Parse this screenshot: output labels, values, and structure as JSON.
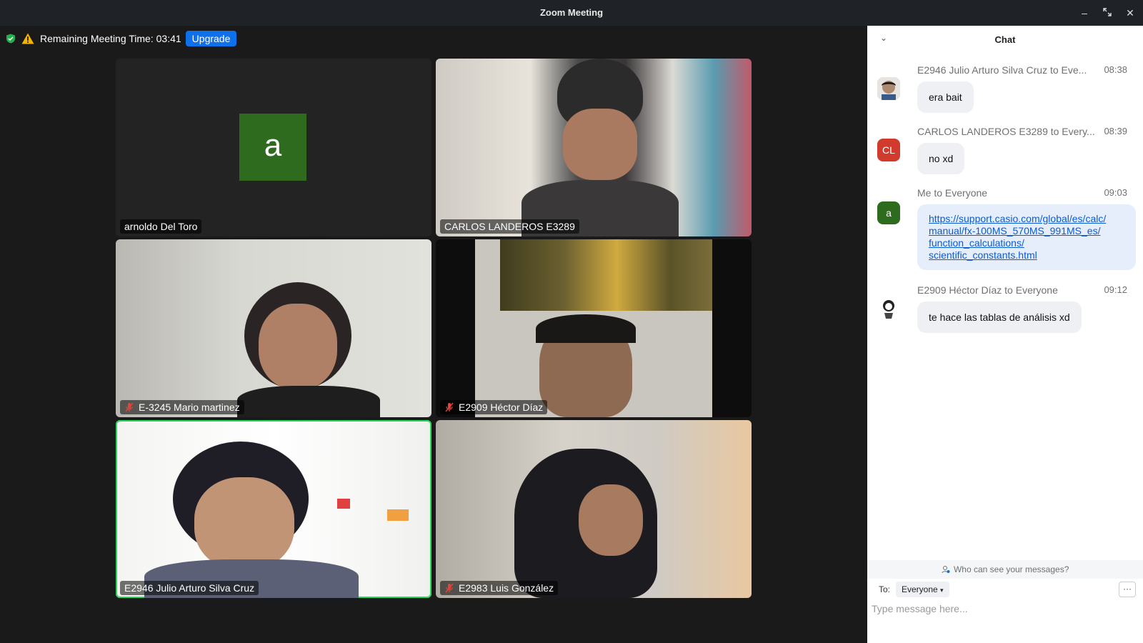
{
  "window": {
    "title": "Zoom Meeting"
  },
  "meeting_bar": {
    "remaining_label": "Remaining Meeting Time: 03:41",
    "upgrade_label": "Upgrade"
  },
  "tiles": [
    {
      "name": "arnoldo Del Toro",
      "avatar_letter": "a",
      "muted": false
    },
    {
      "name": "CARLOS LANDEROS E3289",
      "muted": false
    },
    {
      "name": "E-3245 Mario martinez",
      "muted": true
    },
    {
      "name": "E2909 Héctor Díaz",
      "muted": true
    },
    {
      "name": "E2946 Julio Arturo Silva Cruz",
      "muted": false,
      "active_speaker": true
    },
    {
      "name": "E2983 Luis González",
      "muted": true
    }
  ],
  "chat": {
    "title": "Chat",
    "messages": [
      {
        "sender": "E2946 Julio Arturo Silva Cruz to Eve...",
        "time": "08:38",
        "text": "era bait"
      },
      {
        "sender": "CARLOS LANDEROS E3289 to Every...",
        "time": "08:39",
        "text": "no xd",
        "avatar_text": "CL"
      },
      {
        "sender": "Me to Everyone",
        "time": "09:03",
        "link_line1": "https://support.casio.com/global/es/calc/",
        "link_line2": "manual/fx-100MS_570MS_991MS_es/",
        "link_line3": "function_calculations/",
        "link_line4": "scientific_constants.html",
        "avatar_text": "a"
      },
      {
        "sender": "E2909 Héctor Díaz to Everyone",
        "time": "09:12",
        "text": "te hace las tablas de análisis xd"
      }
    ],
    "who_can_see": "Who can see your messages?",
    "to_label": "To:",
    "recipient": "Everyone",
    "more": "···",
    "input_placeholder": "Type message here..."
  }
}
